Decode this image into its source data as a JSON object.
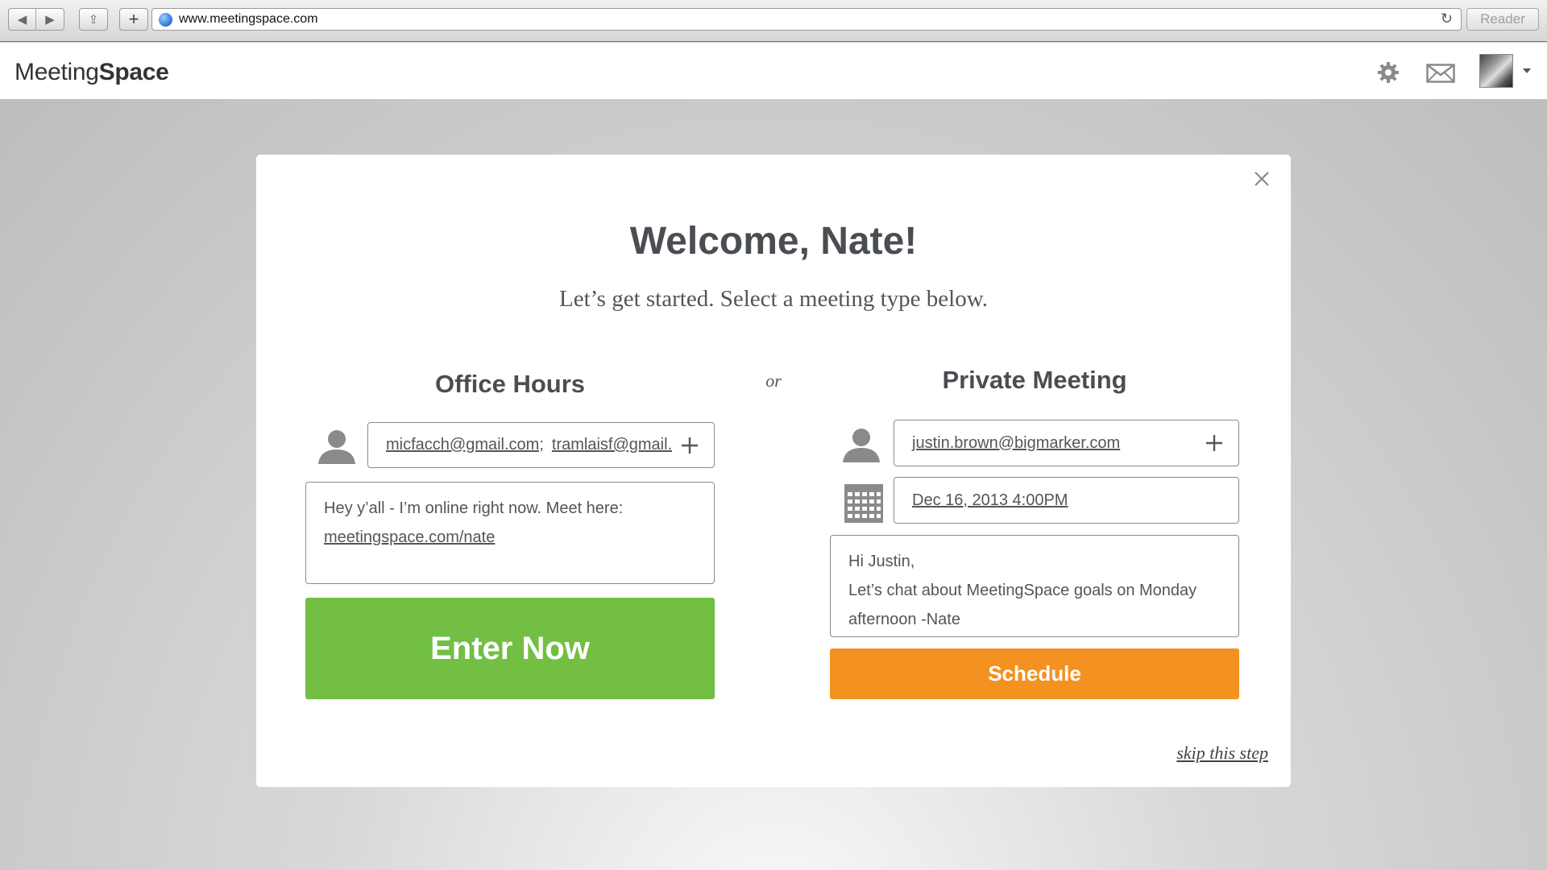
{
  "browser": {
    "back_glyph": "◀",
    "forward_glyph": "▶",
    "share_glyph": "⇪",
    "new_tab_glyph": "+",
    "url": "www.meetingspace.com",
    "reload_glyph": "↻",
    "reader_label": "Reader"
  },
  "header": {
    "logo_light": "Meeting",
    "logo_bold": "Space"
  },
  "modal": {
    "close_glyph": "×",
    "welcome": "Welcome, Nate!",
    "subtitle": "Let’s get started.  Select a meeting type below.",
    "or_label": "or",
    "office_hours": {
      "title": "Office Hours",
      "recipient_1": "micfacch@gmail.com;",
      "recipient_2": "tramlaisf@gmail.",
      "message_line_1": "Hey y’all - I’m online right now. Meet here:",
      "message_link": "meetingspace.com/nate",
      "button_label": "Enter Now"
    },
    "private_meeting": {
      "title": "Private Meeting",
      "recipient": "justin.brown@bigmarker.com",
      "datetime": "Dec 16, 2013  4:00PM",
      "message_line_1": "Hi Justin,",
      "message_line_2": "Let’s chat about MeetingSpace goals on Monday",
      "message_line_3": "afternoon   -Nate",
      "button_label": "Schedule"
    },
    "skip_label": "skip this step"
  },
  "colors": {
    "enter_button": "#72bf44",
    "schedule_button": "#f39220",
    "title_text": "#4a4d52"
  }
}
